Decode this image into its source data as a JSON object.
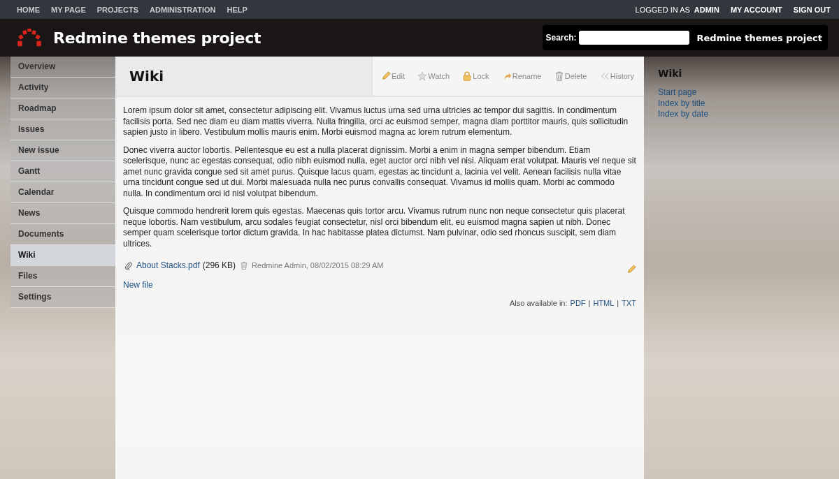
{
  "top_menu": {
    "items": [
      "HOME",
      "MY PAGE",
      "PROJECTS",
      "ADMINISTRATION",
      "HELP"
    ],
    "logged_in_label": "LOGGED IN AS",
    "user": "ADMIN",
    "account_items": [
      "MY ACCOUNT",
      "SIGN OUT"
    ]
  },
  "header": {
    "title": "Redmine themes project",
    "search_label": "Search:",
    "project_jump": "Redmine themes project"
  },
  "main_menu": [
    {
      "label": "Overview",
      "selected": false
    },
    {
      "label": "Activity",
      "selected": false
    },
    {
      "label": "Roadmap",
      "selected": false
    },
    {
      "label": "Issues",
      "selected": false
    },
    {
      "label": "New issue",
      "selected": false
    },
    {
      "label": "Gantt",
      "selected": false
    },
    {
      "label": "Calendar",
      "selected": false
    },
    {
      "label": "News",
      "selected": false
    },
    {
      "label": "Documents",
      "selected": false
    },
    {
      "label": "Wiki",
      "selected": true
    },
    {
      "label": "Files",
      "selected": false
    },
    {
      "label": "Settings",
      "selected": false
    }
  ],
  "page": {
    "title": "Wiki",
    "actions": [
      {
        "kind": "edit",
        "label": "Edit"
      },
      {
        "kind": "watch",
        "label": "Watch"
      },
      {
        "kind": "lock",
        "label": "Lock"
      },
      {
        "kind": "rename",
        "label": "Rename"
      },
      {
        "kind": "delete",
        "label": "Delete"
      },
      {
        "kind": "history",
        "label": "History"
      }
    ],
    "paragraphs": [
      "Lorem ipsum dolor sit amet, consectetur adipiscing elit. Vivamus luctus urna sed urna ultricies ac tempor dui sagittis. In condimentum facilisis porta. Sed nec diam eu diam mattis viverra. Nulla fringilla, orci ac euismod semper, magna diam porttitor mauris, quis sollicitudin sapien justo in libero. Vestibulum mollis mauris enim. Morbi euismod magna ac lorem rutrum elementum.",
      "Donec viverra auctor lobortis. Pellentesque eu est a nulla placerat dignissim. Morbi a enim in magna semper bibendum. Etiam scelerisque, nunc ac egestas consequat, odio nibh euismod nulla, eget auctor orci nibh vel nisi. Aliquam erat volutpat. Mauris vel neque sit amet nunc gravida congue sed sit amet purus. Quisque lacus quam, egestas ac tincidunt a, lacinia vel velit. Aenean facilisis nulla vitae urna tincidunt congue sed ut dui. Morbi malesuada nulla nec purus convallis consequat. Vivamus id mollis quam. Morbi ac commodo nulla. In condimentum orci id nisl volutpat bibendum.",
      "Quisque commodo hendrerit lorem quis egestas. Maecenas quis tortor arcu. Vivamus rutrum nunc non neque consectetur quis placerat neque lobortis. Nam vestibulum, arcu sodales feugiat consectetur, nisl orci bibendum elit, eu euismod magna sapien ut nibh. Donec semper quam scelerisque tortor dictum gravida. In hac habitasse platea dictumst. Nam pulvinar, odio sed rhoncus suscipit, sem diam ultrices."
    ],
    "attachment": {
      "name": "About Stacks.pdf",
      "size": "(296 KB)",
      "author_date": "Redmine Admin, 08/02/2015 08:29 AM"
    },
    "new_file": "New file",
    "other_formats": {
      "label": "Also available in:",
      "separator": "|",
      "formats": [
        "PDF",
        "HTML",
        "TXT"
      ]
    }
  },
  "sidebar": {
    "title": "Wiki",
    "links": [
      "Start page",
      "Index by title",
      "Index by date"
    ]
  }
}
